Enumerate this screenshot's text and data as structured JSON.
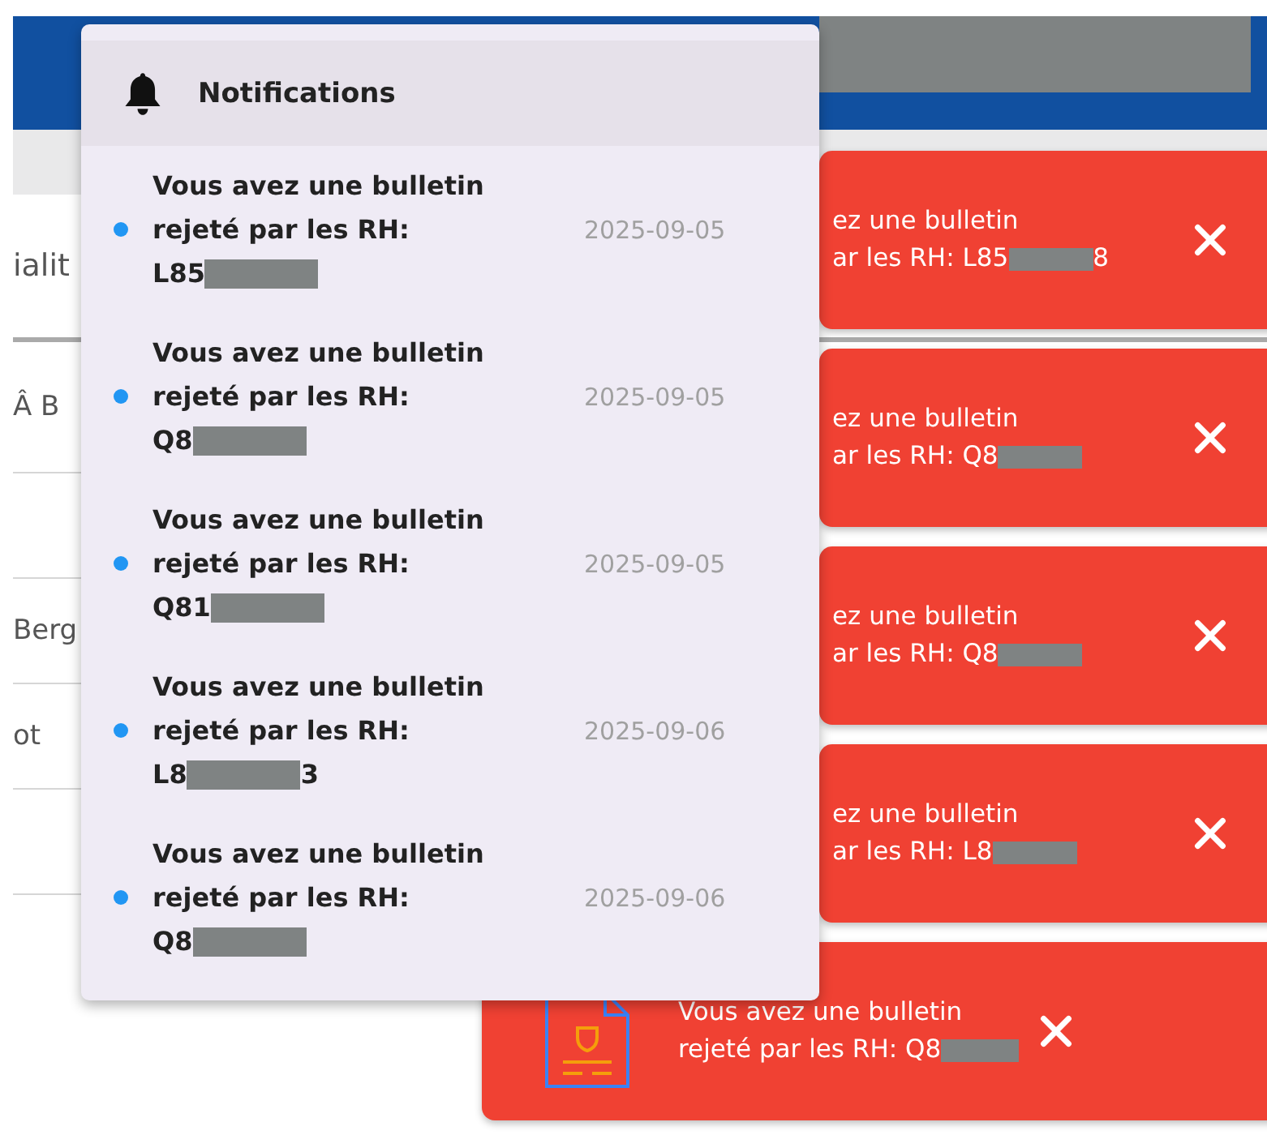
{
  "background": {
    "tab_label": "ialit",
    "cells": [
      "Â B",
      "Berg",
      "ot"
    ]
  },
  "notifications": {
    "title": "Notifications",
    "items": [
      {
        "message": "Vous avez une bulletin rejeté par les RH:",
        "code": "L85",
        "date": "2025-09-05",
        "unread": true
      },
      {
        "message": "Vous avez une bulletin rejeté par les RH:",
        "code": "Q8",
        "date": "2025-09-05",
        "unread": true
      },
      {
        "message": "Vous avez une bulletin rejeté par les RH:",
        "code": "Q81",
        "date": "2025-09-05",
        "unread": true
      },
      {
        "message": "Vous avez une bulletin rejeté par les RH:",
        "code": "L8",
        "code_tail": "3",
        "date": "2025-09-06",
        "unread": true
      },
      {
        "message": "Vous avez une bulletin rejeté par les RH:",
        "code": "Q8",
        "date": "2025-09-06",
        "unread": true
      }
    ]
  },
  "toasts": [
    {
      "kind": "partial",
      "line1": "ez une bulletin",
      "line2": "ar les RH: L85",
      "code_tail": "8"
    },
    {
      "kind": "partial",
      "line1": "ez une bulletin",
      "line2": "ar les RH: Q8"
    },
    {
      "kind": "partial",
      "line1": "ez une bulletin",
      "line2": "ar les RH: Q8"
    },
    {
      "kind": "partial",
      "line1": "ez une bulletin",
      "line2": "ar les RH: L8"
    },
    {
      "kind": "full",
      "line1": "Vous avez une bulletin",
      "line2": "rejeté par les RH: Q8"
    }
  ]
}
